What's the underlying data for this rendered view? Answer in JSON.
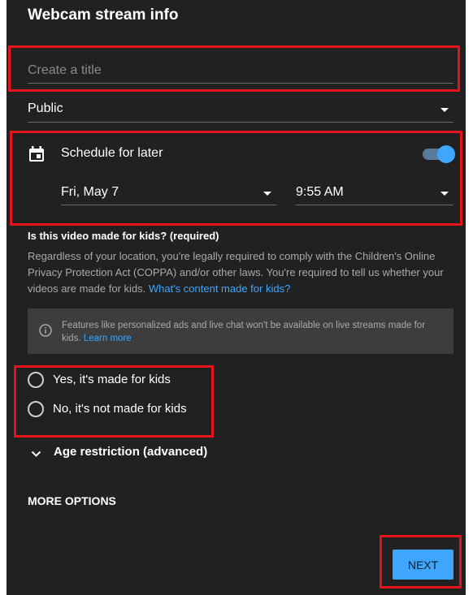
{
  "dialog": {
    "title": "Webcam stream info"
  },
  "title_field": {
    "placeholder": "Create a title",
    "value": ""
  },
  "visibility": {
    "selected": "Public"
  },
  "schedule": {
    "label": "Schedule for later",
    "enabled": true,
    "date": "Fri, May 7",
    "time": "9:55 AM"
  },
  "kids": {
    "question": "Is this video made for kids? (required)",
    "description": "Regardless of your location, you're legally required to comply with the Children's Online Privacy Protection Act (COPPA) and/or other laws. You're required to tell us whether your videos are made for kids.",
    "link": "What's content made for kids?",
    "notice": "Features like personalized ads and live chat won't be available on live streams made for kids.",
    "notice_link": "Learn more",
    "options": [
      {
        "label": "Yes, it's made for kids",
        "selected": false
      },
      {
        "label": "No, it's not made for kids",
        "selected": false
      }
    ]
  },
  "age_restriction": {
    "label": "Age restriction (advanced)"
  },
  "more_options": {
    "label": "MORE OPTIONS"
  },
  "next_button": {
    "label": "NEXT"
  },
  "colors": {
    "background": "#212121",
    "accent": "#3ea6ff",
    "highlight": "#e3141c",
    "secondary_text": "#aaaaaa"
  }
}
